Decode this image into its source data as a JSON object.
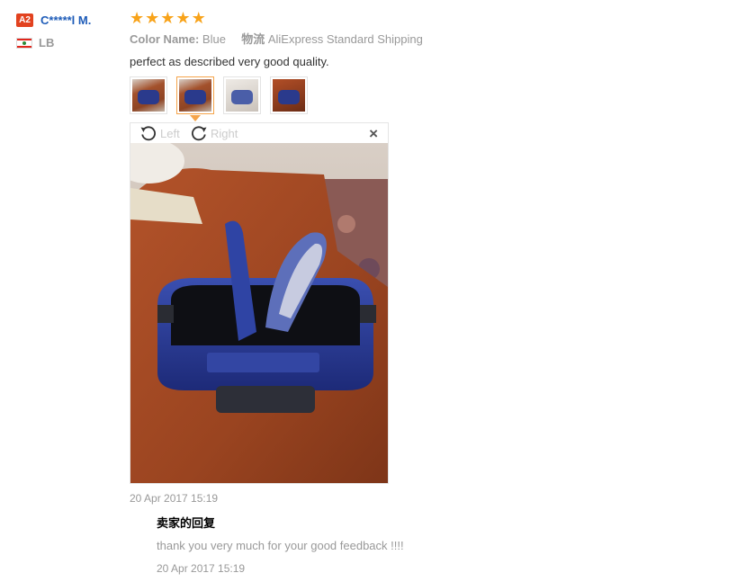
{
  "reviewer": {
    "level_badge": "A2",
    "name": "C*****l M.",
    "country_code": "LB",
    "flag_icon": "lebanon-flag-icon"
  },
  "review": {
    "stars": 5,
    "star_color": "#f8a31a",
    "color_label": "Color Name:",
    "color_value": "Blue",
    "shipping_label": "物流",
    "shipping_value": "AliExpress Standard Shipping",
    "text": "perfect as described very good quality.",
    "date": "20 Apr 2017 15:19",
    "thumbnails": [
      {
        "selected": false
      },
      {
        "selected": true
      },
      {
        "selected": false
      },
      {
        "selected": false
      }
    ]
  },
  "viewer": {
    "rotate_left_label": "Left",
    "rotate_right_label": "Right",
    "close_label": "×"
  },
  "seller_reply": {
    "title": "卖家的回复",
    "text": "thank you very much for your good feedback !!!!",
    "date": "20 Apr 2017 15:19"
  },
  "colors": {
    "username": "#1d5bb8",
    "badge": "#e2421f",
    "selected_thumb_border": "#f5a44a"
  }
}
